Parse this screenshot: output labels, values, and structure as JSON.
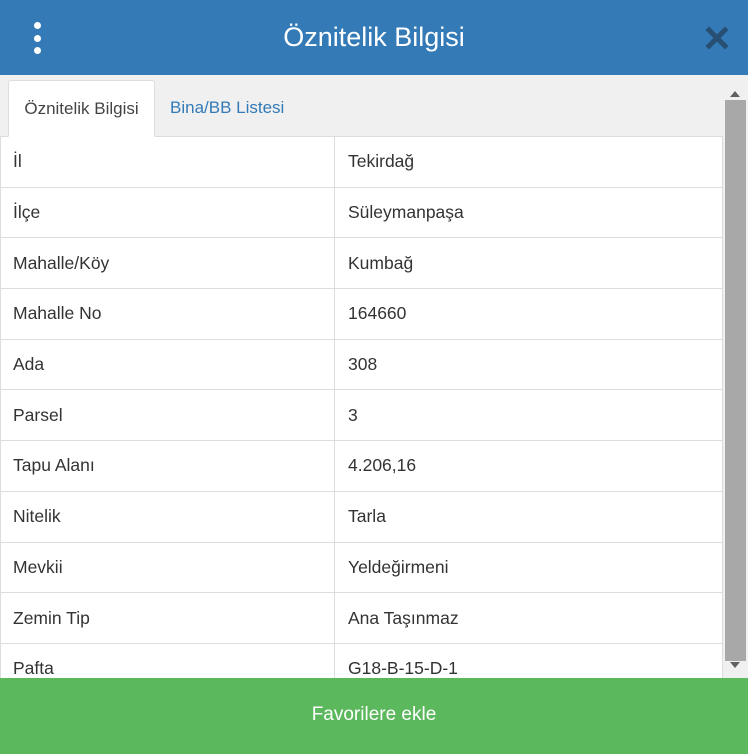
{
  "header": {
    "title": "Öznitelik Bilgisi",
    "menu_icon": "kebab-menu-icon",
    "close_icon": "close-icon",
    "bg_color": "#337ab7"
  },
  "tabs": [
    {
      "label": "Öznitelik Bilgisi",
      "active": true
    },
    {
      "label": "Bina/BB Listesi",
      "active": false
    }
  ],
  "attributes": [
    {
      "label": "İl",
      "value": "Tekirdağ"
    },
    {
      "label": "İlçe",
      "value": "Süleymanpaşa"
    },
    {
      "label": "Mahalle/Köy",
      "value": "Kumbağ"
    },
    {
      "label": "Mahalle No",
      "value": "164660"
    },
    {
      "label": "Ada",
      "value": "308"
    },
    {
      "label": "Parsel",
      "value": "3"
    },
    {
      "label": "Tapu Alanı",
      "value": "4.206,16"
    },
    {
      "label": "Nitelik",
      "value": "Tarla"
    },
    {
      "label": "Mevkii",
      "value": "Yeldeğirmeni"
    },
    {
      "label": "Zemin Tip",
      "value": "Ana Taşınmaz"
    },
    {
      "label": "Pafta",
      "value": "G18-B-15-D-1"
    }
  ],
  "footer": {
    "button_label": "Favorilere ekle",
    "button_color": "#5cb85c"
  }
}
